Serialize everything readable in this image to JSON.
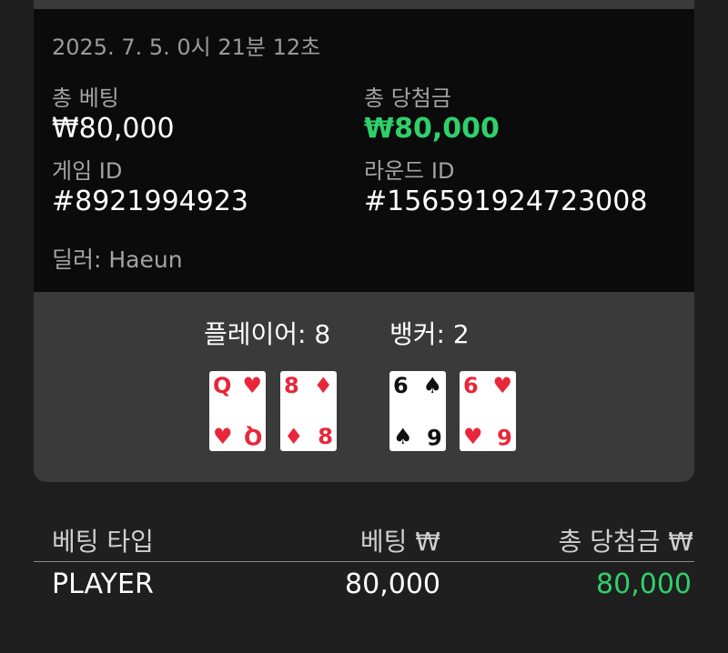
{
  "round": {
    "timestamp": "2025. 7. 5. 0시 21분 12초",
    "total_bet_label": "총 베팅",
    "total_bet_value": "₩80,000",
    "total_win_label": "총 당첨금",
    "total_win_value": "₩80,000",
    "game_id_label": "게임 ID",
    "game_id_value": "#8921994923",
    "round_id_label": "라운드 ID",
    "round_id_value": "#156591924723008",
    "dealer": "딜러: Haeun"
  },
  "hands": {
    "player_label": "플레이어: 8",
    "banker_label": "뱅커: 2",
    "player_cards": [
      {
        "rank": "Q",
        "suit": "♥",
        "color": "#e8273a"
      },
      {
        "rank": "8",
        "suit": "♦",
        "color": "#e8273a"
      }
    ],
    "banker_cards": [
      {
        "rank": "6",
        "suit": "♠",
        "color": "#111111"
      },
      {
        "rank": "6",
        "suit": "♥",
        "color": "#e8273a"
      }
    ]
  },
  "bets_table": {
    "headers": [
      "베팅 타입",
      "베팅 ₩",
      "총 당첨금 ₩"
    ],
    "rows": [
      {
        "type": "PLAYER",
        "bet": "80,000",
        "win": "80,000"
      }
    ]
  },
  "colors": {
    "win_green": "#2fd06b",
    "card_red": "#e8273a",
    "panel_dark": "#0b0b0b",
    "panel_gray": "#3a3a3a"
  }
}
